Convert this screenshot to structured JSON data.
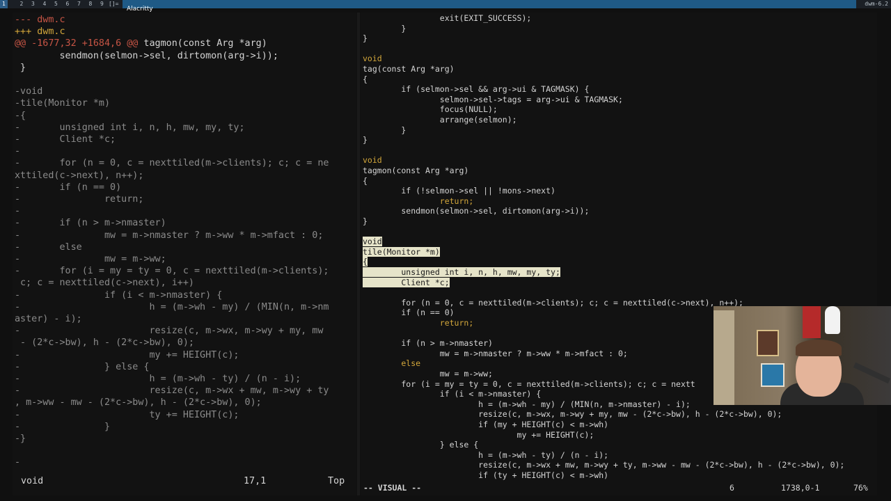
{
  "topbar": {
    "tags": [
      "1",
      "2",
      "3",
      "4",
      "5",
      "6",
      "7",
      "8",
      "9"
    ],
    "layout": "[]=",
    "window_title": "Alacritty",
    "status": "dwm-6.2"
  },
  "left_pane": {
    "lines": [
      {
        "text": "--- dwm.c",
        "cls": "red"
      },
      {
        "text": "+++ dwm.c",
        "cls": "yel"
      },
      {
        "text": "@@ -1677,32 +1684,6 @@ tagmon(const Arg *arg)",
        "cls": "hunk"
      },
      {
        "text": "        sendmon(selmon->sel, dirtomon(arg->i));",
        "cls": ""
      },
      {
        "text": " }",
        "cls": ""
      },
      {
        "text": " ",
        "cls": ""
      },
      {
        "text": "-void",
        "cls": "dim"
      },
      {
        "text": "-tile(Monitor *m)",
        "cls": "dim"
      },
      {
        "text": "-{",
        "cls": "dim"
      },
      {
        "text": "-       unsigned int i, n, h, mw, my, ty;",
        "cls": "dim"
      },
      {
        "text": "-       Client *c;",
        "cls": "dim"
      },
      {
        "text": "-",
        "cls": "dim"
      },
      {
        "text": "-       for (n = 0, c = nexttiled(m->clients); c; c = ne",
        "cls": "dim"
      },
      {
        "text": "xttiled(c->next), n++);",
        "cls": "dim"
      },
      {
        "text": "-       if (n == 0)",
        "cls": "dim"
      },
      {
        "text": "-               return;",
        "cls": "dim"
      },
      {
        "text": "-",
        "cls": "dim"
      },
      {
        "text": "-       if (n > m->nmaster)",
        "cls": "dim"
      },
      {
        "text": "-               mw = m->nmaster ? m->ww * m->mfact : 0;",
        "cls": "dim"
      },
      {
        "text": "-       else",
        "cls": "dim"
      },
      {
        "text": "-               mw = m->ww;",
        "cls": "dim"
      },
      {
        "text": "-       for (i = my = ty = 0, c = nexttiled(m->clients);",
        "cls": "dim"
      },
      {
        "text": " c; c = nexttiled(c->next), i++)",
        "cls": "dim"
      },
      {
        "text": "-               if (i < m->nmaster) {",
        "cls": "dim"
      },
      {
        "text": "-                       h = (m->wh - my) / (MIN(n, m->nm",
        "cls": "dim"
      },
      {
        "text": "aster) - i);",
        "cls": "dim"
      },
      {
        "text": "-                       resize(c, m->wx, m->wy + my, mw",
        "cls": "dim"
      },
      {
        "text": " - (2*c->bw), h - (2*c->bw), 0);",
        "cls": "dim"
      },
      {
        "text": "-                       my += HEIGHT(c);",
        "cls": "dim"
      },
      {
        "text": "-               } else {",
        "cls": "dim"
      },
      {
        "text": "-                       h = (m->wh - ty) / (n - i);",
        "cls": "dim"
      },
      {
        "text": "-                       resize(c, m->wx + mw, m->wy + ty",
        "cls": "dim"
      },
      {
        "text": ", m->ww - mw - (2*c->bw), h - (2*c->bw), 0);",
        "cls": "dim"
      },
      {
        "text": "-                       ty += HEIGHT(c);",
        "cls": "dim"
      },
      {
        "text": "-               }",
        "cls": "dim"
      },
      {
        "text": "-}",
        "cls": "dim"
      },
      {
        "text": " ",
        "cls": ""
      },
      {
        "text": "-",
        "cls": "dim"
      }
    ],
    "bottom_word": "void",
    "position": "17,1",
    "scroll": "Top"
  },
  "right_pane": {
    "lines": [
      {
        "text": "                exit(EXIT_SUCCESS);",
        "cls": ""
      },
      {
        "text": "        }",
        "cls": ""
      },
      {
        "text": "}",
        "cls": ""
      },
      {
        "text": "",
        "cls": ""
      },
      {
        "text": "void",
        "cls": "yel"
      },
      {
        "text": "tag(const Arg *arg)",
        "cls": ""
      },
      {
        "text": "{",
        "cls": ""
      },
      {
        "text": "        if (selmon->sel && arg->ui & TAGMASK) {",
        "cls": ""
      },
      {
        "text": "                selmon->sel->tags = arg->ui & TAGMASK;",
        "cls": ""
      },
      {
        "text": "                focus(NULL);",
        "cls": ""
      },
      {
        "text": "                arrange(selmon);",
        "cls": ""
      },
      {
        "text": "        }",
        "cls": ""
      },
      {
        "text": "}",
        "cls": ""
      },
      {
        "text": "",
        "cls": ""
      },
      {
        "text": "void",
        "cls": "yel"
      },
      {
        "text": "tagmon(const Arg *arg)",
        "cls": ""
      },
      {
        "text": "{",
        "cls": ""
      },
      {
        "text": "        if (!selmon->sel || !mons->next)",
        "cls": ""
      },
      {
        "text": "                return;",
        "cls": "yel"
      },
      {
        "text": "        sendmon(selmon->sel, dirtomon(arg->i));",
        "cls": ""
      },
      {
        "text": "}",
        "cls": ""
      },
      {
        "text": "",
        "cls": ""
      },
      {
        "text": "void",
        "cls": "sel"
      },
      {
        "text": "tile(Monitor *m)",
        "cls": "sel"
      },
      {
        "text": "{",
        "cls": "sel"
      },
      {
        "text": "        unsigned int i, n, h, mw, my, ty;",
        "cls": "sel"
      },
      {
        "text": "        Client *c;",
        "cls": "sel"
      },
      {
        "text": "",
        "cls": ""
      },
      {
        "text": "        for (n = 0, c = nexttiled(m->clients); c; c = nexttiled(c->next), n++);",
        "cls": ""
      },
      {
        "text": "        if (n == 0)",
        "cls": ""
      },
      {
        "text": "                return;",
        "cls": "yel"
      },
      {
        "text": "",
        "cls": ""
      },
      {
        "text": "        if (n > m->nmaster)",
        "cls": ""
      },
      {
        "text": "                mw = m->nmaster ? m->ww * m->mfact : 0;",
        "cls": ""
      },
      {
        "text": "        else",
        "cls": "yel"
      },
      {
        "text": "                mw = m->ww;",
        "cls": ""
      },
      {
        "text": "        for (i = my = ty = 0, c = nexttiled(m->clients); c; c = nextt",
        "cls": ""
      },
      {
        "text": "                if (i < m->nmaster) {",
        "cls": ""
      },
      {
        "text": "                        h = (m->wh - my) / (MIN(n, m->nmaster) - i);",
        "cls": ""
      },
      {
        "text": "                        resize(c, m->wx, m->wy + my, mw - (2*c->bw), h - (2*c->bw), 0);",
        "cls": ""
      },
      {
        "text": "                        if (my + HEIGHT(c) < m->wh)",
        "cls": ""
      },
      {
        "text": "                                my += HEIGHT(c);",
        "cls": ""
      },
      {
        "text": "                } else {",
        "cls": ""
      },
      {
        "text": "                        h = (m->wh - ty) / (n - i);",
        "cls": ""
      },
      {
        "text": "                        resize(c, m->wx + mw, m->wy + ty, m->ww - mw - (2*c->bw), h - (2*c->bw), 0);",
        "cls": ""
      },
      {
        "text": "                        if (ty + HEIGHT(c) < m->wh)",
        "cls": ""
      }
    ],
    "mode": "-- VISUAL --",
    "count": "6",
    "position": "1738,0-1",
    "percent": "76%"
  }
}
